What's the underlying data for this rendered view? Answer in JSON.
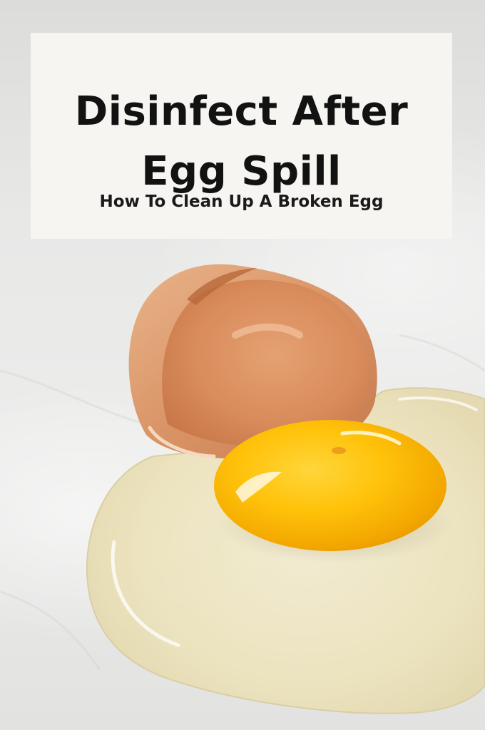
{
  "title": {
    "line1": "Disinfect After",
    "line2": "Egg Spill"
  },
  "subtitle": "How To Clean Up A Broken Egg",
  "colors": {
    "card_background": "#f6f5f1",
    "text": "#121212",
    "yolk": "#f5b400",
    "shell": "#d88e5c",
    "egg_white": "#efe8c6",
    "countertop": "#e8e8e7"
  }
}
